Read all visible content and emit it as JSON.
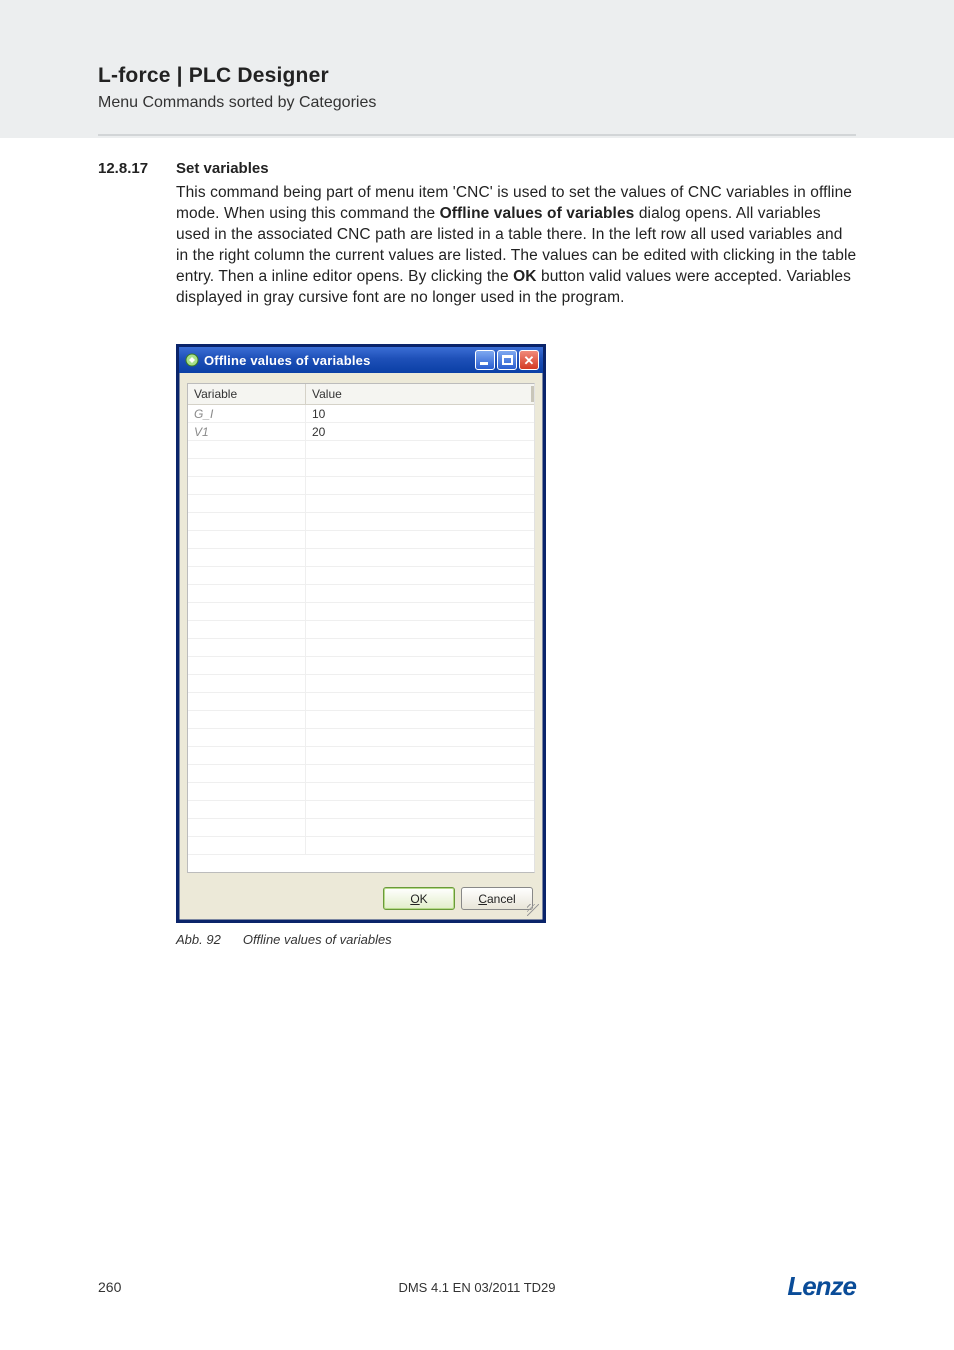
{
  "header": {
    "title": "L-force | PLC Designer",
    "subtitle": "Menu Commands sorted by Categories"
  },
  "section": {
    "number": "12.8.17",
    "heading": "Set variables",
    "paragraph_parts": {
      "p1": "This command being part of menu item 'CNC' is used to set the values of CNC variables in offline mode.  When using this command the ",
      "b1": "Offline values of variables",
      "p2": " dialog opens. All variables used in the associated CNC path are listed in a table there. In the left row all used variables and in the right column the current values are listed. The values can be edited with clicking in the table entry.  Then a inline editor opens. By clicking the ",
      "b2": "OK",
      "p3": " button valid values were accepted. Variables displayed in gray cursive font are no longer used in the program."
    }
  },
  "dialog": {
    "title": "Offline values of variables",
    "columns": {
      "variable": "Variable",
      "value": "Value"
    },
    "rows": [
      {
        "variable": "G_I",
        "value": "10"
      },
      {
        "variable": "V1",
        "value": "20"
      }
    ],
    "empty_row_count": 23,
    "buttons": {
      "ok_u": "O",
      "ok_rest": "K",
      "cancel_u": "C",
      "cancel_rest": "ancel"
    }
  },
  "figure": {
    "label": "Abb. 92",
    "caption": "Offline values of variables"
  },
  "footer": {
    "page": "260",
    "center": "DMS 4.1 EN 03/2011 TD29",
    "logo": "Lenze"
  }
}
